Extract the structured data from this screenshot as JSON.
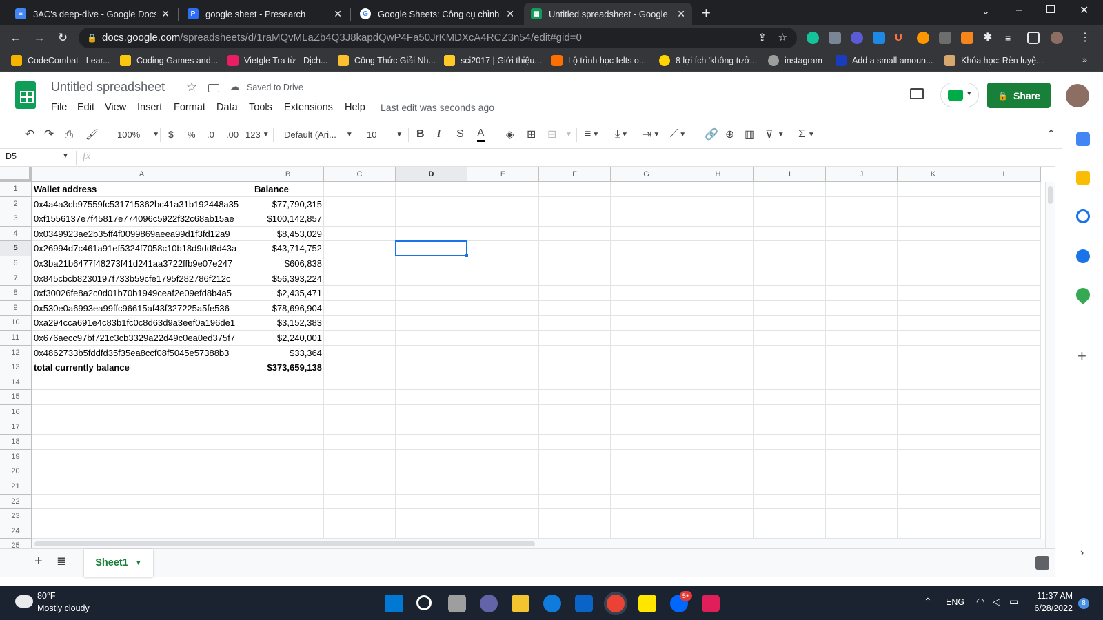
{
  "browser": {
    "tabs": [
      {
        "title": "3AC's deep-dive - Google Docs",
        "icon": "docs-icon",
        "color": "#4285f4"
      },
      {
        "title": "google sheet - Presearch",
        "icon": "presearch-icon",
        "color": "#2d6ef6"
      },
      {
        "title": "Google Sheets: Công cụ chỉnh sử",
        "icon": "google-icon",
        "color": "#ffffff"
      },
      {
        "title": "Untitled spreadsheet - Google Sh",
        "icon": "sheets-icon",
        "color": "#0f9d58"
      }
    ],
    "url_host": "docs.google.com",
    "url_path": "/spreadsheets/d/1raMQvMLaZb4Q3J8kapdQwP4Fa50JrKMDXcA4RCZ3n54/edit#gid=0",
    "bookmarks": [
      {
        "label": "CodeCombat - Lear...",
        "color": "#f4b400"
      },
      {
        "label": "Coding Games and...",
        "color": "#f9c80e"
      },
      {
        "label": "Vietgle Tra từ - Dịch...",
        "color": "#e91e63"
      },
      {
        "label": "Công Thức Giải Nh...",
        "color": "#fbc02d"
      },
      {
        "label": "sci2017 | Giới thiệu...",
        "color": "#ffca28"
      },
      {
        "label": "Lộ trình học Ielts o...",
        "color": "#ff6f00"
      },
      {
        "label": "8 lợi ích 'không tưở...",
        "color": "#ffd600"
      },
      {
        "label": "instagram",
        "color": "#9e9e9e"
      },
      {
        "label": "Add a small amoun...",
        "color": "#1a3dbf"
      },
      {
        "label": "Khóa học: Rèn luyệ...",
        "color": "#d7a86e"
      }
    ]
  },
  "doc": {
    "title": "Untitled spreadsheet",
    "saved_status": "Saved to Drive",
    "menu": [
      "File",
      "Edit",
      "View",
      "Insert",
      "Format",
      "Data",
      "Tools",
      "Extensions",
      "Help"
    ],
    "last_edit": "Last edit was seconds ago",
    "share_label": "Share"
  },
  "toolbar": {
    "zoom": "100%",
    "currency": "$",
    "percent": "%",
    "dec_decrease": ".0",
    "dec_increase": ".00",
    "more_formats": "123",
    "font": "Default (Ari...",
    "font_size": "10"
  },
  "formula": {
    "cell_ref": "D5",
    "fx": "fx"
  },
  "sheet": {
    "columns": [
      "A",
      "B",
      "C",
      "D",
      "E",
      "F",
      "G",
      "H",
      "I",
      "J",
      "K",
      "L"
    ],
    "selected_column": "D",
    "selected_row": 5,
    "row_count": 25,
    "rows": [
      {
        "a": "Wallet address",
        "b": "Balance",
        "bold": true,
        "b_align": "left"
      },
      {
        "a": "0x4a4a3cb97559fc531715362bc41a31b192448a35",
        "b": "$77,790,315"
      },
      {
        "a": "0xf1556137e7f45817e774096c5922f32c68ab15ae",
        "b": "$100,142,857"
      },
      {
        "a": "0x0349923ae2b35ff4f0099869aeea99d1f3fd12a9",
        "b": "$8,453,029"
      },
      {
        "a": "0x26994d7c461a91ef5324f7058c10b18d9dd8d43a",
        "b": "$43,714,752"
      },
      {
        "a": "0x3ba21b6477f48273f41d241aa3722ffb9e07e247",
        "b": "$606,838"
      },
      {
        "a": "0x845cbcb8230197f733b59cfe1795f282786f212c",
        "b": "$56,393,224"
      },
      {
        "a": "0xf30026fe8a2c0d01b70b1949ceaf2e09efd8b4a5",
        "b": "$2,435,471"
      },
      {
        "a": "0x530e0a6993ea99ffc96615af43f327225a5fe536",
        "b": "$78,696,904"
      },
      {
        "a": "0xa294cca691e4c83b1fc0c8d63d9a3eef0a196de1",
        "b": "$3,152,383"
      },
      {
        "a": "0x676aecc97bf721c3cb3329a22d49c0ea0ed375f7",
        "b": "$2,240,001"
      },
      {
        "a": "0x4862733b5fddfd35f35ea8ccf08f5045e57388b3",
        "b": "$33,364"
      },
      {
        "a": "total currently balance",
        "b": "$373,659,138",
        "bold": true
      }
    ],
    "tab_name": "Sheet1"
  },
  "taskbar": {
    "temperature": "80°F",
    "weather": "Mostly cloudy",
    "language": "ENG",
    "time": "11:37 AM",
    "date": "6/28/2022",
    "notification_badge": "5+",
    "corner_badge": "8"
  }
}
